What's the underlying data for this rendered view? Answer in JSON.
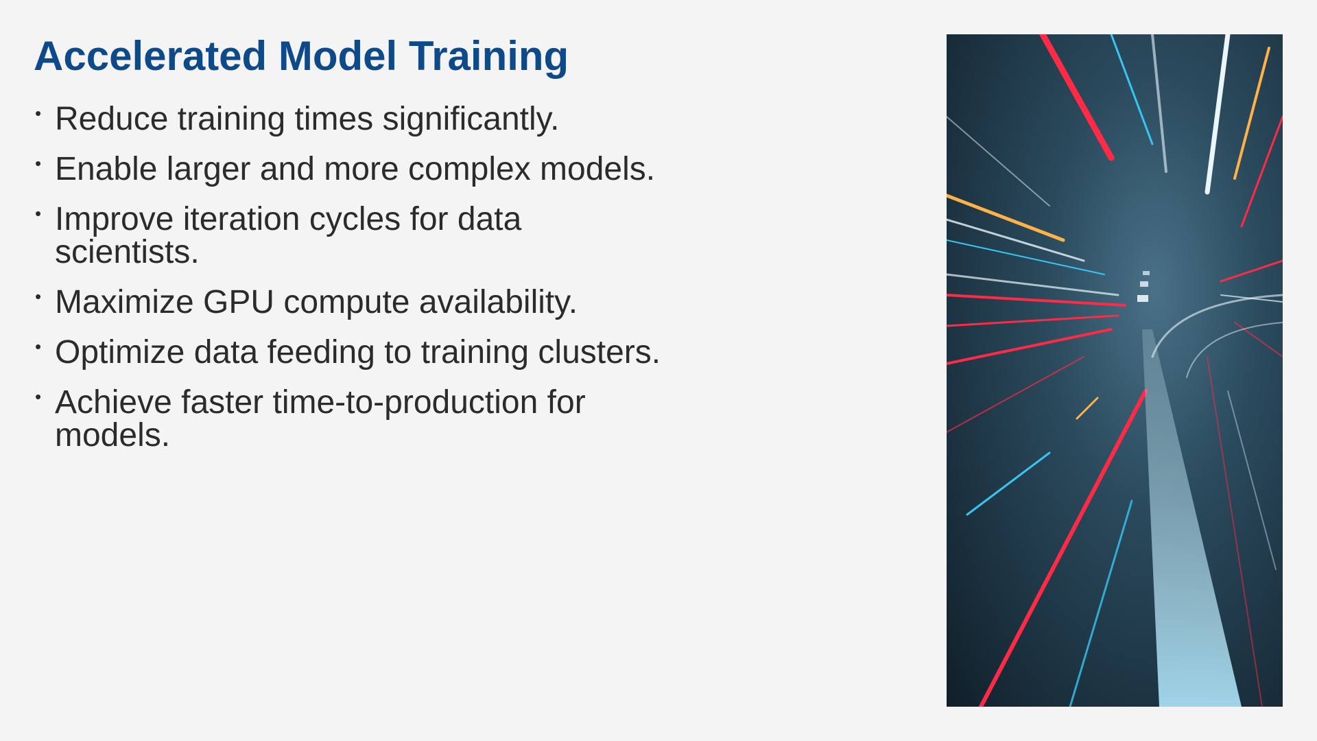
{
  "slide": {
    "title": "Accelerated Model Training",
    "bullet_marker": "•",
    "bullets": [
      "Reduce training times significantly.",
      "Enable larger and more complex models.",
      "Improve iteration cycles for data scientists.",
      "Maximize GPU compute availability.",
      "Optimize data feeding to training clusters.",
      "Achieve faster time-to-production for models."
    ]
  },
  "image": {
    "subject": "light-speed-tunnel-image",
    "colors": {
      "background": "#14242f",
      "streak_red": "#ff2a45",
      "streak_cyan": "#37c6f2",
      "streak_orange": "#ffb347",
      "streak_white": "#eaf6fb"
    }
  },
  "colors": {
    "slide_background": "#f4f4f4",
    "title": "#0e4a8a",
    "body_text": "#2b2b2b"
  }
}
